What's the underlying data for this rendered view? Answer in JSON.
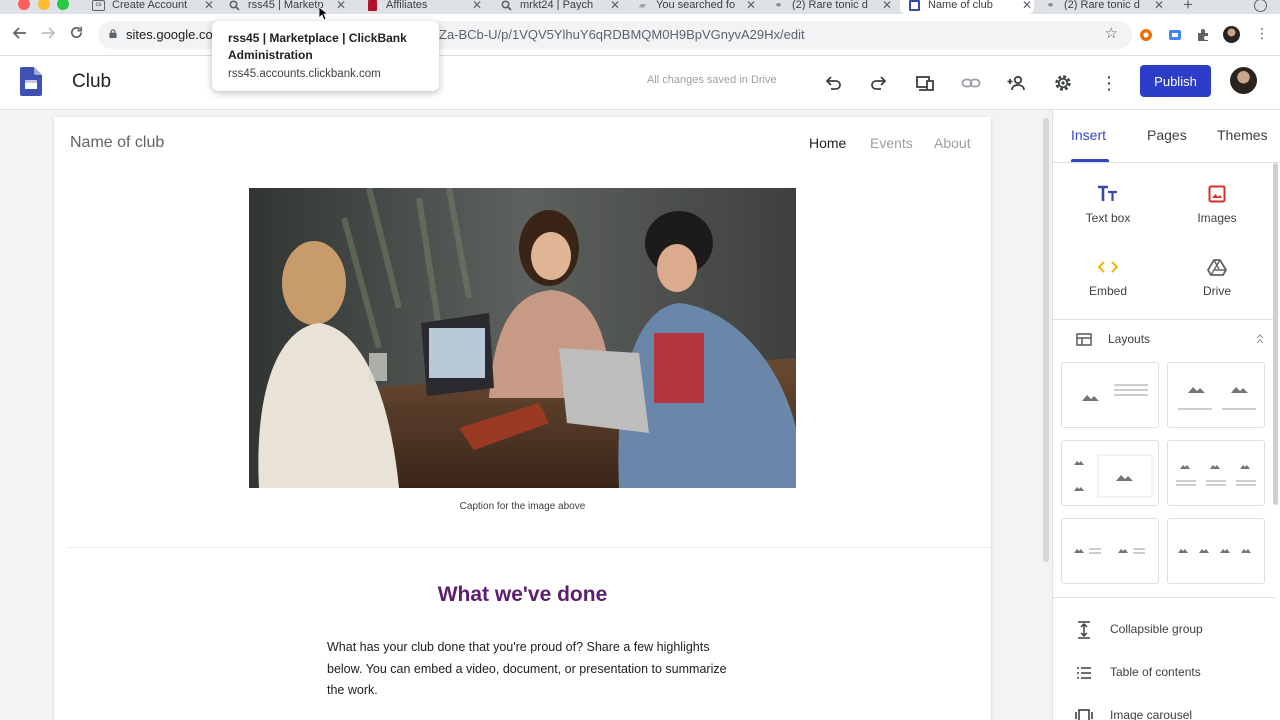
{
  "browser": {
    "tabs": [
      {
        "label": "Create Account",
        "favicon": "cs-icon"
      },
      {
        "label": "rss45 | Marketp",
        "favicon": "magnifier-icon"
      },
      {
        "label": "Affiliates",
        "favicon": "clickbank-icon"
      },
      {
        "label": "mrkt24 | Paych",
        "favicon": "magnifier-icon"
      },
      {
        "label": "You searched fo",
        "favicon": "book-icon"
      },
      {
        "label": "(2) Rare tonic d",
        "favicon": "link-icon"
      },
      {
        "label": "Name of club",
        "favicon": "sites-icon"
      },
      {
        "label": "(2) Rare tonic d",
        "favicon": "link-icon"
      }
    ],
    "url_left": "sites.google.co",
    "url_right": "Za-BCb-U/p/1VQV5YlhuY6qRDBMQM0H9BpVGnyvA29Hx/edit",
    "tooltip": {
      "title": "rss45 | Marketplace | ClickBank Administration",
      "url": "rss45.accounts.clickbank.com"
    }
  },
  "app": {
    "title": "Club",
    "save_status": "All changes saved in Drive",
    "publish_label": "Publish",
    "accent": "#2c3ec7"
  },
  "site": {
    "name": "Name of club",
    "nav": [
      "Home",
      "Events",
      "About"
    ],
    "image_caption": "Caption for the image above",
    "section_title": "What we've done",
    "section_body": "What has your club done that you're proud of? Share a few highlights below. You can embed a video, document, or presentation to summarize the work.",
    "title_color": "#5d1e6e"
  },
  "panel": {
    "tabs": [
      "Insert",
      "Pages",
      "Themes"
    ],
    "insert_items": [
      {
        "label": "Text box",
        "icon": "text-box-icon"
      },
      {
        "label": "Images",
        "icon": "image-icon"
      },
      {
        "label": "Embed",
        "icon": "embed-icon"
      },
      {
        "label": "Drive",
        "icon": "drive-icon"
      }
    ],
    "layouts_label": "Layouts",
    "extra_items": [
      {
        "label": "Collapsible group",
        "icon": "collapsible-icon"
      },
      {
        "label": "Table of contents",
        "icon": "toc-icon"
      },
      {
        "label": "Image carousel",
        "icon": "carousel-icon"
      }
    ]
  }
}
